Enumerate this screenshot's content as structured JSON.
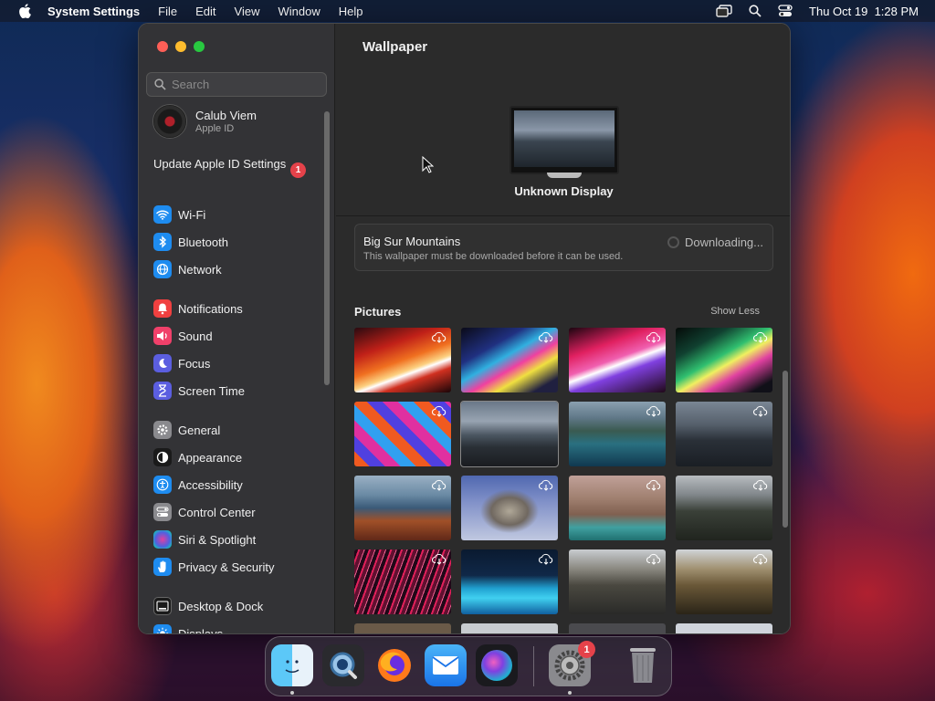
{
  "menubar": {
    "app_name": "System Settings",
    "menus": [
      "File",
      "Edit",
      "View",
      "Window",
      "Help"
    ],
    "datetime": "Thu Oct 19  1:28 PM",
    "icons": [
      "apple-icon",
      "screen-mirroring-icon",
      "spotlight-search-icon",
      "control-center-icon"
    ]
  },
  "sidebar": {
    "search_placeholder": "Search",
    "account": {
      "name": "Calub Viem",
      "subtitle": "Apple ID"
    },
    "update": {
      "label": "Update Apple ID Settings",
      "badge": "1"
    },
    "items": [
      {
        "label": "Wi-Fi",
        "color": "#1e8cf0",
        "icon": "wifi-icon"
      },
      {
        "label": "Bluetooth",
        "color": "#1e8cf0",
        "icon": "bluetooth-icon"
      },
      {
        "label": "Network",
        "color": "#1e8cf0",
        "icon": "globe-icon"
      },
      {
        "label": "Notifications",
        "color": "#f04040",
        "icon": "bell-icon"
      },
      {
        "label": "Sound",
        "color": "#f0406a",
        "icon": "speaker-icon"
      },
      {
        "label": "Focus",
        "color": "#5b5ee0",
        "icon": "moon-icon"
      },
      {
        "label": "Screen Time",
        "color": "#5b5ee0",
        "icon": "hourglass-icon"
      },
      {
        "label": "General",
        "color": "#8a8a8e",
        "icon": "gear-icon"
      },
      {
        "label": "Appearance",
        "color": "#1a1a1a",
        "icon": "appearance-icon"
      },
      {
        "label": "Accessibility",
        "color": "#1e8cf0",
        "icon": "accessibility-icon"
      },
      {
        "label": "Control Center",
        "color": "#8a8a8e",
        "icon": "toggles-icon"
      },
      {
        "label": "Siri & Spotlight",
        "color": "#2a2a2a",
        "icon": "siri-icon"
      },
      {
        "label": "Privacy & Security",
        "color": "#1e8cf0",
        "icon": "hand-icon"
      },
      {
        "label": "Desktop & Dock",
        "color": "#1a1a1a",
        "icon": "dock-icon"
      },
      {
        "label": "Displays",
        "color": "#1e8cf0",
        "icon": "sun-icon"
      }
    ]
  },
  "main": {
    "title": "Wallpaper",
    "display_name": "Unknown Display",
    "current_wallpaper": {
      "name": "Big Sur Mountains",
      "note": "This wallpaper must be downloaded before it can be used.",
      "status": "Downloading..."
    },
    "section_title": "Pictures",
    "section_action": "Show Less"
  },
  "dock": {
    "apps": [
      "finder",
      "quicktime",
      "firefox",
      "mail",
      "siri",
      "system-settings",
      "trash"
    ],
    "settings_badge": "1"
  }
}
